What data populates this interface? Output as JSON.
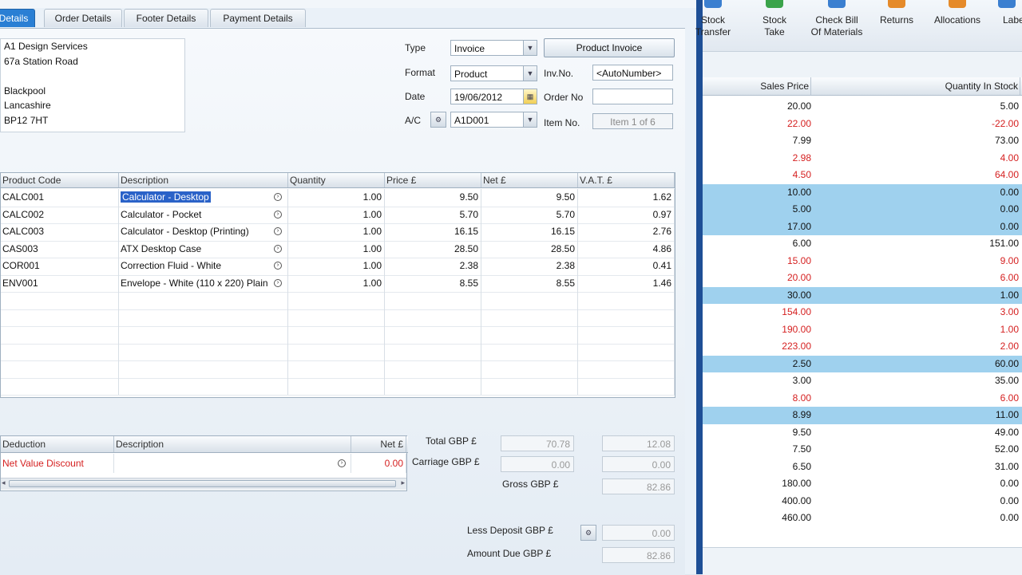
{
  "tabs": [
    "Details",
    "Order Details",
    "Footer Details",
    "Payment Details"
  ],
  "address": [
    "A1 Design Services",
    "67a Station Road",
    "",
    "Blackpool",
    "Lancashire",
    "BP12 7HT"
  ],
  "form": {
    "type_label": "Type",
    "type_value": "Invoice",
    "format_label": "Format",
    "format_value": "Product",
    "date_label": "Date",
    "date_value": "19/06/2012",
    "ac_label": "A/C",
    "ac_value": "A1D001",
    "product_invoice_label": "Product Invoice",
    "inv_no_label": "Inv.No.",
    "inv_no_value": "<AutoNumber>",
    "order_no_label": "Order No",
    "order_no_value": "",
    "item_no_label": "Item No.",
    "item_no_value": "Item 1 of 6"
  },
  "grid": {
    "headers": [
      "Product Code",
      "Description",
      "Quantity",
      "Price £",
      "Net £",
      "V.A.T. £"
    ],
    "rows": [
      {
        "code": "CALC001",
        "desc": "Calculator - Desktop",
        "qty": "1.00",
        "price": "9.50",
        "net": "9.50",
        "vat": "1.62"
      },
      {
        "code": "CALC002",
        "desc": "Calculator - Pocket",
        "qty": "1.00",
        "price": "5.70",
        "net": "5.70",
        "vat": "0.97"
      },
      {
        "code": "CALC003",
        "desc": "Calculator - Desktop (Printing)",
        "qty": "1.00",
        "price": "16.15",
        "net": "16.15",
        "vat": "2.76"
      },
      {
        "code": "CAS003",
        "desc": "ATX Desktop Case",
        "qty": "1.00",
        "price": "28.50",
        "net": "28.50",
        "vat": "4.86"
      },
      {
        "code": "COR001",
        "desc": "Correction Fluid - White",
        "qty": "1.00",
        "price": "2.38",
        "net": "2.38",
        "vat": "0.41"
      },
      {
        "code": "ENV001",
        "desc": "Envelope - White (110 x 220) Plain",
        "qty": "1.00",
        "price": "8.55",
        "net": "8.55",
        "vat": "1.46"
      }
    ]
  },
  "deduction": {
    "headers": [
      "Deduction",
      "Description",
      "Net £"
    ],
    "row": {
      "name": "Net Value Discount",
      "desc": "",
      "net": "0.00"
    }
  },
  "totals": {
    "total_label": "Total GBP £",
    "total_net": "70.78",
    "total_vat": "12.08",
    "carriage_label": "Carriage GBP £",
    "carriage_net": "0.00",
    "carriage_vat": "0.00",
    "gross_label": "Gross GBP £",
    "gross_value": "82.86",
    "deposit_label": "Less Deposit GBP £",
    "deposit_value": "0.00",
    "due_label": "Amount Due GBP £",
    "due_value": "82.86"
  },
  "ribbon": [
    {
      "label1": "Stock",
      "label2": "Transfer"
    },
    {
      "label1": "Stock",
      "label2": "Take"
    },
    {
      "label1": "Check Bill",
      "label2": "Of Materials"
    },
    {
      "label1": "Returns",
      "label2": ""
    },
    {
      "label1": "Allocations",
      "label2": ""
    },
    {
      "label1": "Labels",
      "label2": ""
    }
  ],
  "stock": {
    "headers": [
      "Sales Price",
      "Quantity In Stock"
    ],
    "rows": [
      {
        "price": "20.00",
        "qty": "5.00",
        "red": false,
        "hl": false
      },
      {
        "price": "22.00",
        "qty": "-22.00",
        "red": true,
        "hl": false
      },
      {
        "price": "7.99",
        "qty": "73.00",
        "red": false,
        "hl": false
      },
      {
        "price": "2.98",
        "qty": "4.00",
        "red": true,
        "hl": false
      },
      {
        "price": "4.50",
        "qty": "64.00",
        "red": true,
        "hl": false
      },
      {
        "price": "10.00",
        "qty": "0.00",
        "red": false,
        "hl": true
      },
      {
        "price": "5.00",
        "qty": "0.00",
        "red": false,
        "hl": true
      },
      {
        "price": "17.00",
        "qty": "0.00",
        "red": false,
        "hl": true
      },
      {
        "price": "6.00",
        "qty": "151.00",
        "red": false,
        "hl": false
      },
      {
        "price": "15.00",
        "qty": "9.00",
        "red": true,
        "hl": false
      },
      {
        "price": "20.00",
        "qty": "6.00",
        "red": true,
        "hl": false
      },
      {
        "price": "30.00",
        "qty": "1.00",
        "red": false,
        "hl": true
      },
      {
        "price": "154.00",
        "qty": "3.00",
        "red": true,
        "hl": false
      },
      {
        "price": "190.00",
        "qty": "1.00",
        "red": true,
        "hl": false
      },
      {
        "price": "223.00",
        "qty": "2.00",
        "red": true,
        "hl": false
      },
      {
        "price": "2.50",
        "qty": "60.00",
        "red": false,
        "hl": true
      },
      {
        "price": "3.00",
        "qty": "35.00",
        "red": false,
        "hl": false
      },
      {
        "price": "8.00",
        "qty": "6.00",
        "red": true,
        "hl": false
      },
      {
        "price": "8.99",
        "qty": "11.00",
        "red": false,
        "hl": true
      },
      {
        "price": "9.50",
        "qty": "49.00",
        "red": false,
        "hl": false
      },
      {
        "price": "7.50",
        "qty": "52.00",
        "red": false,
        "hl": false
      },
      {
        "price": "6.50",
        "qty": "31.00",
        "red": false,
        "hl": false
      },
      {
        "price": "180.00",
        "qty": "0.00",
        "red": false,
        "hl": false
      },
      {
        "price": "400.00",
        "qty": "0.00",
        "red": false,
        "hl": false
      },
      {
        "price": "460.00",
        "qty": "0.00",
        "red": false,
        "hl": false
      }
    ]
  },
  "colors": {
    "accent": "#2a7fd4",
    "highlight": "#9fd1ee",
    "negative": "#d52020",
    "divider": "#1e4f96"
  }
}
